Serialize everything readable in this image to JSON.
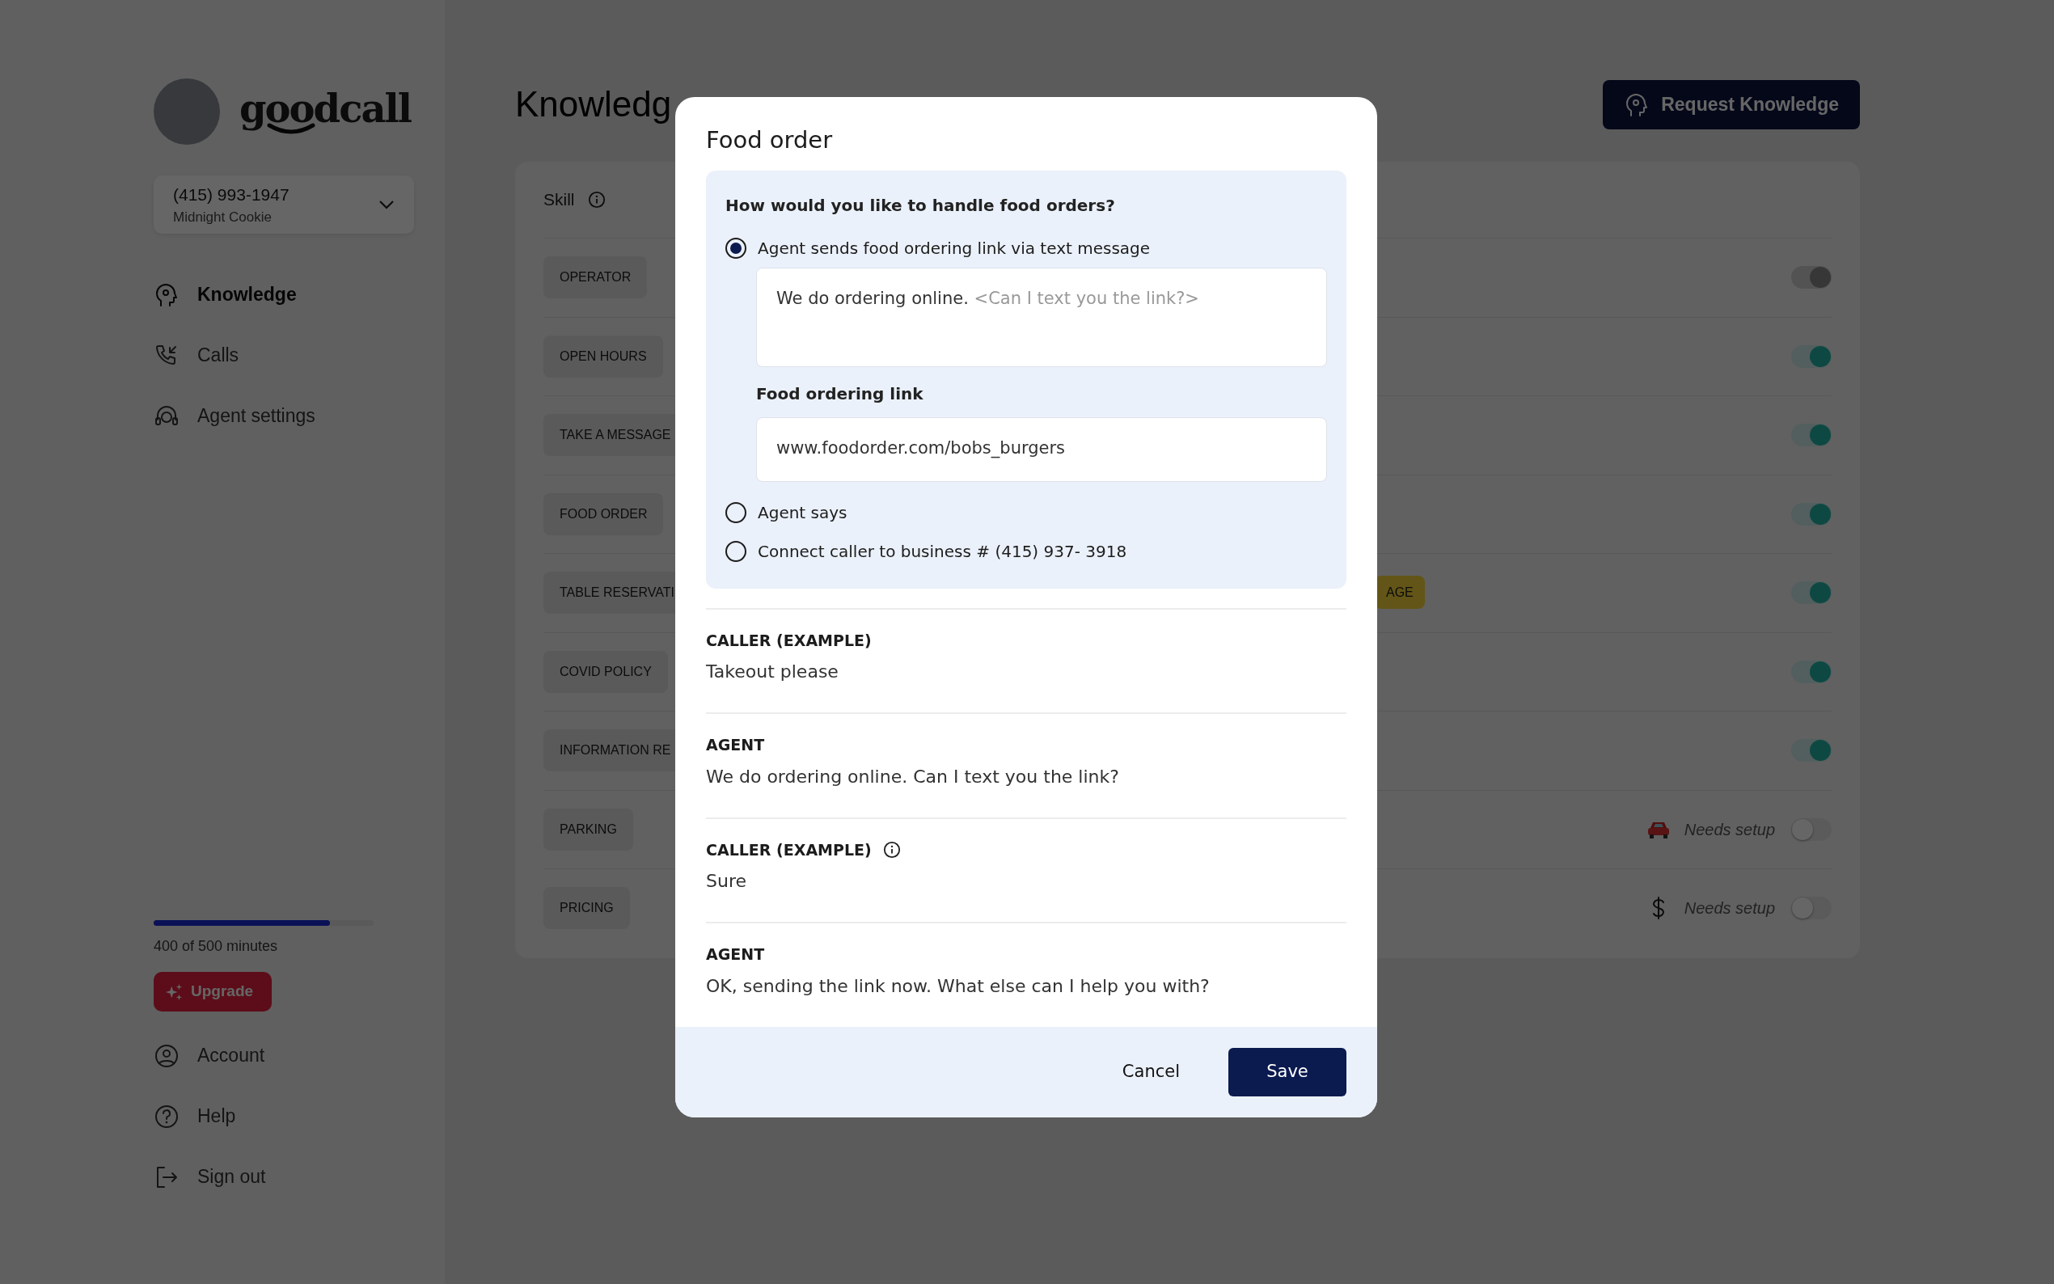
{
  "sidebar": {
    "logo": "goodcall",
    "phone": {
      "number": "(415) 993-1947",
      "name": "Midnight Cookie"
    },
    "nav": [
      {
        "label": "Knowledge",
        "selected": true
      },
      {
        "label": "Calls",
        "selected": false
      },
      {
        "label": "Agent settings",
        "selected": false
      }
    ],
    "usage": {
      "level": 0.8,
      "text": "400 of 500 minutes"
    },
    "upgrade_button": "Upgrade",
    "footer_nav": [
      {
        "label": "Account"
      },
      {
        "label": "Help"
      },
      {
        "label": "Sign out"
      }
    ]
  },
  "page": {
    "title": "Knowledg",
    "request_button": "Request Knowledge"
  },
  "skills": {
    "header": "Skill",
    "rows": [
      {
        "label": "OPERATOR",
        "on": true,
        "disabled": true
      },
      {
        "label": "OPEN HOURS",
        "on": true,
        "disabled": false
      },
      {
        "label": "TAKE A MESSAGE",
        "on": true,
        "disabled": false
      },
      {
        "label": "FOOD ORDER",
        "on": true,
        "disabled": false
      },
      {
        "label": "TABLE RESERVATI",
        "on": true,
        "disabled": false,
        "tag": "AGE"
      },
      {
        "label": "COVID POLICY",
        "on": true,
        "disabled": false
      },
      {
        "label": "INFORMATION RE",
        "on": true,
        "disabled": false
      },
      {
        "label": "PARKING",
        "on": false,
        "disabled": false,
        "status": "Needs setup"
      },
      {
        "label": "PRICING",
        "on": false,
        "disabled": false,
        "status": "Needs setup"
      }
    ]
  },
  "dialog": {
    "title": "Food order",
    "question": "How would you like to handle food orders?",
    "options": [
      {
        "label": "Agent sends food ordering link via text message",
        "selected": true
      },
      {
        "label": "Agent says",
        "selected": false
      },
      {
        "label": "Connect caller to business # (415) 937- 3918",
        "selected": false
      }
    ],
    "message": {
      "value": "We do ordering online.",
      "suggestion": "<Can I text you the link?>"
    },
    "link": {
      "label": "Food ordering link",
      "value": "www.foodorder.com/bobs_burgers"
    },
    "conversation": [
      {
        "speaker": "CALLER (EXAMPLE)",
        "text": "Takeout please",
        "info": false
      },
      {
        "speaker": "AGENT",
        "text": "We do ordering online. Can I text you the link?",
        "info": false
      },
      {
        "speaker": "CALLER (EXAMPLE)",
        "text": "Sure",
        "info": true
      },
      {
        "speaker": "AGENT",
        "text": "OK, sending the link now. What else can I help you with?",
        "info": false
      }
    ],
    "buttons": {
      "cancel": "Cancel",
      "save": "Save"
    }
  }
}
